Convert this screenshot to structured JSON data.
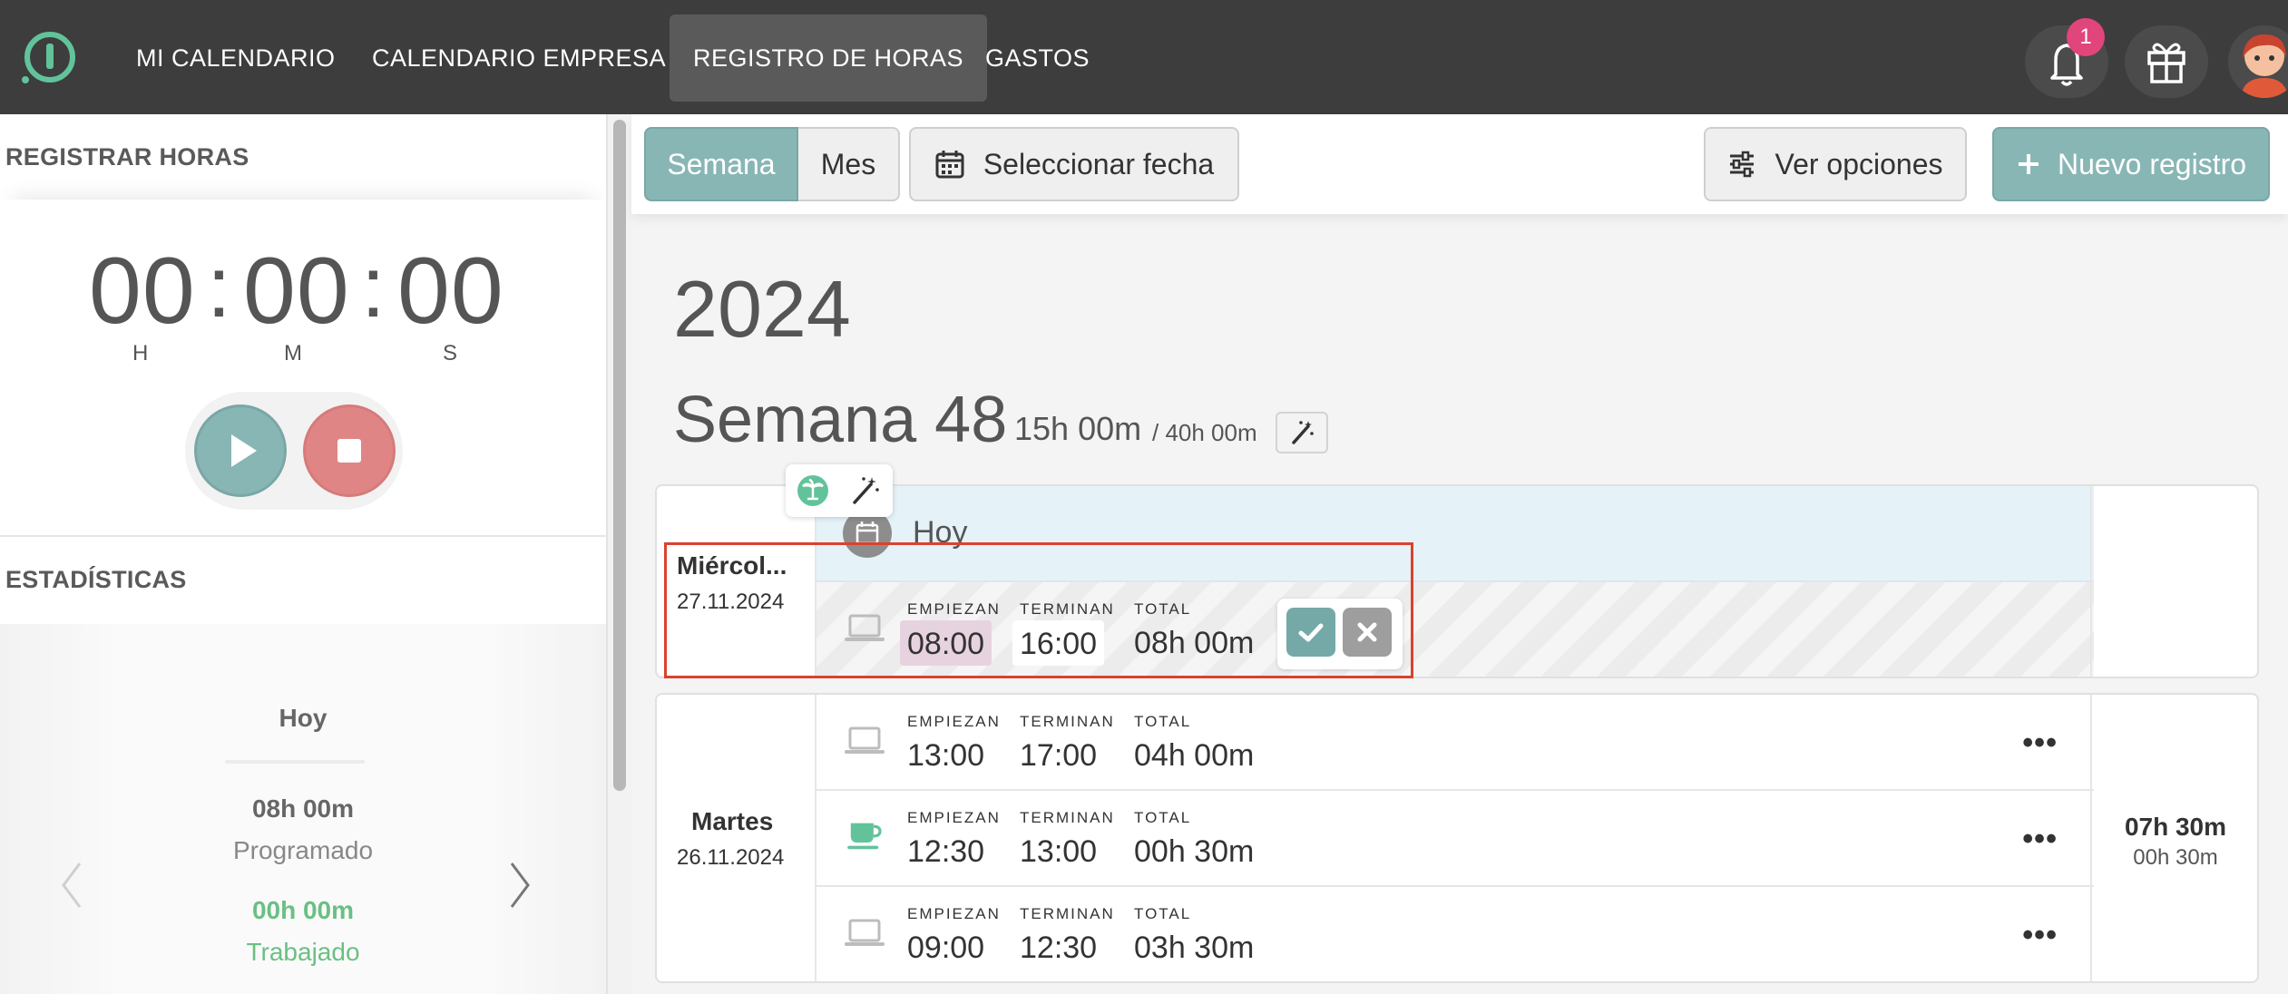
{
  "nav": {
    "items": [
      {
        "label": "MI CALENDARIO"
      },
      {
        "label": "CALENDARIO EMPRESA"
      },
      {
        "label": "REGISTRO DE HORAS",
        "active": true
      },
      {
        "label": "GASTOS"
      }
    ],
    "notification_count": "1"
  },
  "timer": {
    "title": "REGISTRAR HORAS",
    "hours": "00",
    "minutes": "00",
    "seconds": "00",
    "sep": ":",
    "unit_h": "H",
    "unit_m": "M",
    "unit_s": "S"
  },
  "stats": {
    "title": "ESTADÍSTICAS",
    "period": "Hoy",
    "scheduled_value": "08h 00m",
    "scheduled_label": "Programado",
    "worked_value": "00h 00m",
    "worked_label": "Trabajado"
  },
  "toolbar": {
    "week_label": "Semana",
    "month_label": "Mes",
    "select_date_label": "Seleccionar fecha",
    "options_label": "Ver opciones",
    "new_record_label": "Nuevo registro"
  },
  "summary": {
    "year": "2024",
    "week_title": "Semana 48",
    "week_hours": "15h 00m",
    "week_target": "/ 40h 00m"
  },
  "labels": {
    "start": "EMPIEZAN",
    "end": "TERMINAN",
    "total": "TOTAL",
    "more": "•••"
  },
  "days": [
    {
      "name": "Miércol...",
      "date": "27.11.2024",
      "today_label": "Hoy",
      "editing": {
        "start": "08:00",
        "end": "16:00",
        "total": "08h 00m"
      }
    },
    {
      "name": "Martes",
      "date": "26.11.2024",
      "total": "07h 30m",
      "break_total": "00h 30m",
      "entries": [
        {
          "type": "laptop",
          "start": "13:00",
          "end": "17:00",
          "total": "04h 00m"
        },
        {
          "type": "coffee",
          "start": "12:30",
          "end": "13:00",
          "total": "00h 30m"
        },
        {
          "type": "laptop",
          "start": "09:00",
          "end": "12:30",
          "total": "03h 30m"
        }
      ]
    }
  ],
  "colors": {
    "nav_bg": "#3d3d3d",
    "teal": "#88b6b5",
    "red": "#e08585",
    "green": "#62c39b",
    "highlight": "#d9432e"
  }
}
